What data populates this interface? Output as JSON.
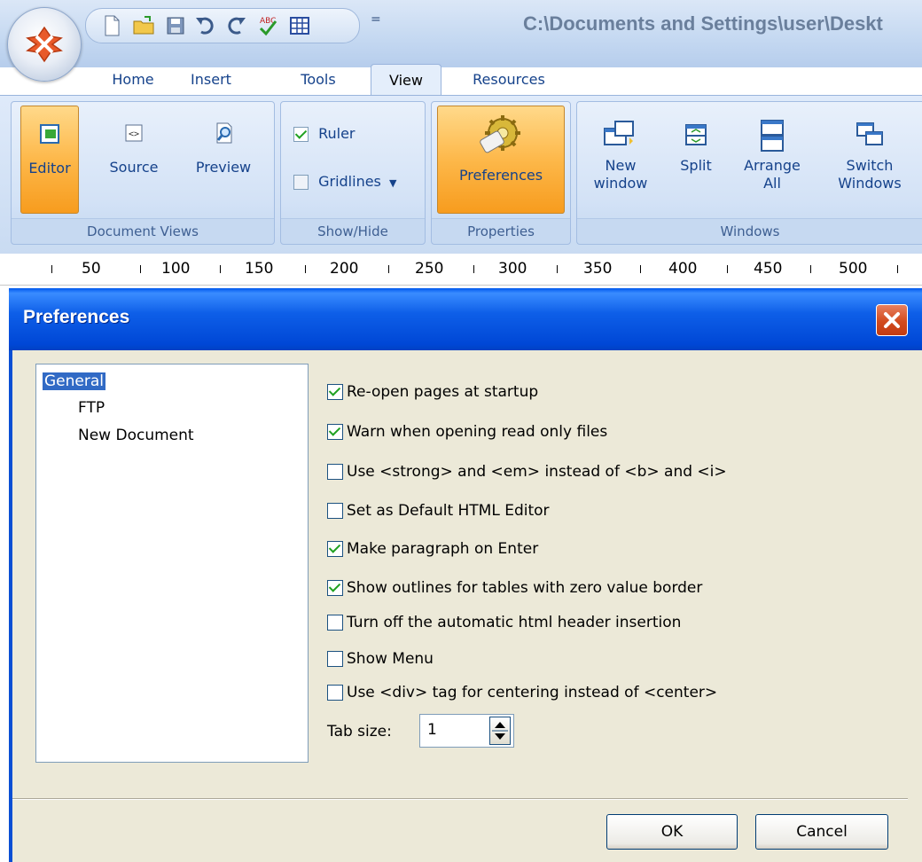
{
  "window": {
    "title_path": "C:\\Documents and Settings\\user\\Deskt"
  },
  "qat": {
    "icons": [
      "new-document-icon",
      "open-folder-icon",
      "save-icon",
      "undo-icon",
      "redo-icon",
      "spellcheck-icon",
      "table-icon"
    ],
    "more": "="
  },
  "tabs": [
    "Home",
    "Insert",
    "Tools",
    "View",
    "Resources"
  ],
  "ribbon": {
    "document_views": {
      "label": "Document Views",
      "buttons": [
        "Editor",
        "Source",
        "Preview"
      ]
    },
    "show_hide": {
      "label": "Show/Hide",
      "ruler": "Ruler",
      "ruler_checked": true,
      "gridlines": "Gridlines",
      "gridlines_checked": false
    },
    "properties": {
      "label": "Properties",
      "button": "Preferences"
    },
    "windows": {
      "label": "Windows",
      "new_window_1": "New",
      "new_window_2": "window",
      "split": "Split",
      "arrange_1": "Arrange",
      "arrange_2": "All",
      "switch_1": "Switch",
      "switch_2": "Windows"
    }
  },
  "ruler": [
    "50",
    "100",
    "150",
    "200",
    "250",
    "300",
    "350",
    "400",
    "450",
    "500"
  ],
  "dialog": {
    "title": "Preferences",
    "tree": [
      "General",
      "FTP",
      "New Document"
    ],
    "tree_selected": "General",
    "options": [
      {
        "label": "Re-open pages at startup",
        "checked": true
      },
      {
        "label": "Warn when opening read only files",
        "checked": true
      },
      {
        "label": "Use <strong> and <em> instead of <b> and <i>",
        "checked": false
      },
      {
        "label": "Set as Default HTML Editor",
        "checked": false
      },
      {
        "label": "Make paragraph on Enter",
        "checked": true
      },
      {
        "label": "Show outlines for tables with zero value border",
        "checked": true
      },
      {
        "label": "Turn off the automatic html header insertion",
        "checked": false
      },
      {
        "label": "Show Menu",
        "checked": false
      },
      {
        "label": "Use <div> tag for centering instead of <center>",
        "checked": false
      }
    ],
    "tab_size_label": "Tab size:",
    "tab_size_value": "1",
    "ok": "OK",
    "cancel": "Cancel"
  }
}
